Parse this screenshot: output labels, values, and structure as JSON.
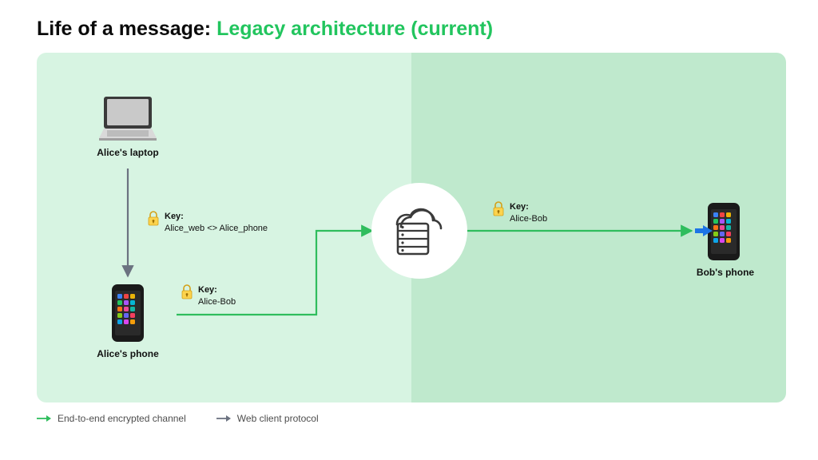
{
  "title": {
    "prefix": "Life of a message: ",
    "accent": "Legacy architecture (current)"
  },
  "nodes": {
    "alice_laptop": "Alice's laptop",
    "alice_phone": "Alice's phone",
    "bob_phone": "Bob's phone"
  },
  "keys": {
    "laptop_phone": {
      "label": "Key:",
      "value": "Alice_web <> Alice_phone"
    },
    "phone_server": {
      "label": "Key:",
      "value": "Alice-Bob"
    },
    "server_bob": {
      "label": "Key:",
      "value": "Alice-Bob"
    }
  },
  "legend": {
    "e2ee": "End-to-end encrypted channel",
    "web": "Web client protocol"
  },
  "colors": {
    "accent": "#22c55e",
    "arrow_green": "#2fbd5d",
    "arrow_gray": "#6b7280"
  }
}
